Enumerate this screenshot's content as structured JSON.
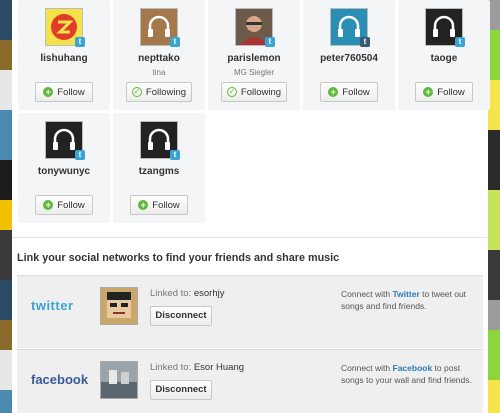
{
  "users": [
    {
      "username": "lishuhang",
      "realname": "",
      "button": "Follow",
      "state": "follow",
      "avatar": "stylized-logo-avatar",
      "badge": "twitter-badge"
    },
    {
      "username": "nepttako",
      "realname": "tina",
      "button": "Following",
      "state": "following",
      "avatar": "headphones-avatar",
      "badge": "twitter-badge"
    },
    {
      "username": "parislemon",
      "realname": "MG Siegler",
      "button": "Following",
      "state": "following",
      "avatar": "portrait-photo-avatar",
      "badge": "twitter-badge"
    },
    {
      "username": "peter760504",
      "realname": "",
      "button": "Follow",
      "state": "follow",
      "avatar": "headphones-avatar",
      "badge": "tumblr-badge"
    },
    {
      "username": "taoge",
      "realname": "",
      "button": "Follow",
      "state": "follow",
      "avatar": "headphones-avatar",
      "badge": "twitter-badge"
    },
    {
      "username": "tonywunyc",
      "realname": "",
      "button": "Follow",
      "state": "follow",
      "avatar": "headphones-avatar",
      "badge": "twitter-badge"
    },
    {
      "username": "tzangms",
      "realname": "",
      "button": "Follow",
      "state": "follow",
      "avatar": "headphones-avatar",
      "badge": "twitter-badge"
    }
  ],
  "social_section": {
    "title": "Link your social networks to find your friends and share music",
    "twitter": {
      "logo": "twitter",
      "linked_label": "Linked to:",
      "linked_name": "esorhjy",
      "button": "Disconnect",
      "desc_pre": "Connect with ",
      "desc_link": "Twitter",
      "desc_post": " to tweet out songs and find friends."
    },
    "facebook": {
      "logo": "facebook",
      "linked_label": "Linked to:",
      "linked_name": "Esor Huang",
      "button": "Disconnect",
      "desc_pre": "Connect with ",
      "desc_link": "Facebook",
      "desc_post": " to post songs to your wall and find friends."
    }
  },
  "colors": {
    "follow_green": "#5fb83b",
    "twitter_blue": "#3aa3d6",
    "facebook_blue": "#3b5998",
    "link_blue": "#2b7bb9",
    "card_bg": "#f3f5f7"
  }
}
